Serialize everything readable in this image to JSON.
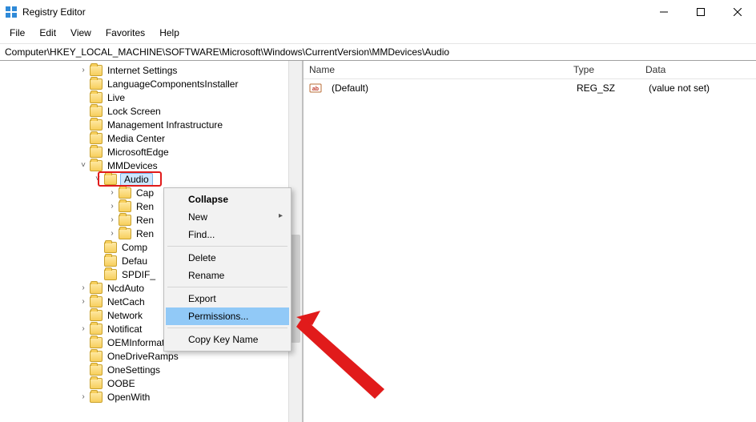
{
  "window": {
    "title": "Registry Editor"
  },
  "menubar": [
    "File",
    "Edit",
    "View",
    "Favorites",
    "Help"
  ],
  "address": "Computer\\HKEY_LOCAL_MACHINE\\SOFTWARE\\Microsoft\\Windows\\CurrentVersion\\MMDevices\\Audio",
  "tree": {
    "items": [
      {
        "indent": 112,
        "expander": ">",
        "label": "Internet Settings"
      },
      {
        "indent": 112,
        "expander": "",
        "label": "LanguageComponentsInstaller"
      },
      {
        "indent": 112,
        "expander": "",
        "label": "Live"
      },
      {
        "indent": 112,
        "expander": "",
        "label": "Lock Screen"
      },
      {
        "indent": 112,
        "expander": "",
        "label": "Management Infrastructure"
      },
      {
        "indent": 112,
        "expander": "",
        "label": "Media Center"
      },
      {
        "indent": 112,
        "expander": "",
        "label": "MicrosoftEdge"
      },
      {
        "indent": 112,
        "expander": "v",
        "label": "MMDevices"
      },
      {
        "indent": 130,
        "expander": "v",
        "label": "Audio",
        "selected": true
      },
      {
        "indent": 148,
        "expander": ">",
        "label": "Cap"
      },
      {
        "indent": 148,
        "expander": ">",
        "label": "Ren"
      },
      {
        "indent": 148,
        "expander": ">",
        "label": "Ren"
      },
      {
        "indent": 148,
        "expander": ">",
        "label": "Ren"
      },
      {
        "indent": 130,
        "expander": "",
        "label": "Comp"
      },
      {
        "indent": 130,
        "expander": "",
        "label": "Defau"
      },
      {
        "indent": 130,
        "expander": "",
        "label": "SPDIF_"
      },
      {
        "indent": 112,
        "expander": ">",
        "label": "NcdAuto"
      },
      {
        "indent": 112,
        "expander": ">",
        "label": "NetCach"
      },
      {
        "indent": 112,
        "expander": "",
        "label": "Network"
      },
      {
        "indent": 112,
        "expander": ">",
        "label": "Notificat"
      },
      {
        "indent": 112,
        "expander": "",
        "label": "OEMInformation"
      },
      {
        "indent": 112,
        "expander": "",
        "label": "OneDriveRamps"
      },
      {
        "indent": 112,
        "expander": "",
        "label": "OneSettings"
      },
      {
        "indent": 112,
        "expander": "",
        "label": "OOBE"
      },
      {
        "indent": 112,
        "expander": ">",
        "label": "OpenWith"
      }
    ]
  },
  "context_menu": {
    "items": [
      {
        "label": "Collapse",
        "bold": true
      },
      {
        "label": "New",
        "submenu": true
      },
      {
        "label": "Find..."
      },
      {
        "sep": true
      },
      {
        "label": "Delete"
      },
      {
        "label": "Rename"
      },
      {
        "sep": true
      },
      {
        "label": "Export"
      },
      {
        "label": "Permissions...",
        "highlighted": true
      },
      {
        "sep": true
      },
      {
        "label": "Copy Key Name"
      }
    ]
  },
  "list": {
    "columns": {
      "name": "Name",
      "type": "Type",
      "data": "Data"
    },
    "rows": [
      {
        "name": "(Default)",
        "type": "REG_SZ",
        "data": "(value not set)"
      }
    ]
  }
}
